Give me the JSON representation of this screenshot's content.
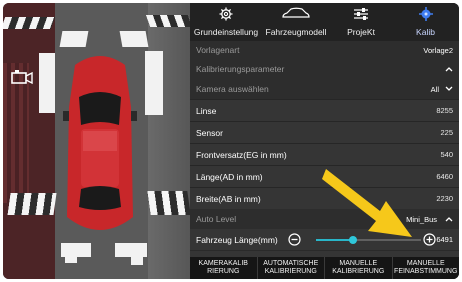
{
  "tabs": [
    {
      "label": "Grundeinstellung",
      "icon": "gear-icon"
    },
    {
      "label": "Fahrzeugmodell",
      "icon": "car-outline-icon"
    },
    {
      "label": "ProjeKt",
      "icon": "sliders-icon"
    },
    {
      "label": "Kalib",
      "icon": "crosshair-icon",
      "active": true
    }
  ],
  "settings": {
    "vorlagenart_label": "Vorlagenart",
    "vorlagenart_value": "Vorlage2",
    "kalibrierungsparameter_label": "Kalibrierungsparameter",
    "kamera_label": "Kamera auswählen",
    "kamera_value": "All",
    "linse_label": "Linse",
    "linse_value": "8255",
    "sensor_label": "Sensor",
    "sensor_value": "225",
    "frontversatz_label": "Frontversatz(EG in mm)",
    "frontversatz_value": "540",
    "laenge_label": "Länge(AD in mm)",
    "laenge_value": "6460",
    "breite_label": "Breite(AB in mm)",
    "breite_value": "2230",
    "autolevel_label": "Auto Level",
    "autolevel_value": "Mini_Bus",
    "fahrzeuglaenge_label": "Fahrzeug Länge(mm)",
    "fahrzeuglaenge_value": "6491",
    "fahrzeuglaenge_fraction": 0.35
  },
  "bottom_buttons": [
    {
      "line1": "KAMERAKALIB",
      "line2": "RIERUNG"
    },
    {
      "line1": "AUTOMATISCHE",
      "line2": "KALIBRIERUNG"
    },
    {
      "line1": "MANUELLE",
      "line2": "KALIBRIERUNG"
    },
    {
      "line1": "MANUELLE",
      "line2": "FEINABSTIMMUNG"
    }
  ],
  "colors": {
    "accent": "#2fc7da",
    "arrow": "#f6c81a",
    "car": "#c8272a",
    "active_tab_icon": "#3f7df0"
  }
}
